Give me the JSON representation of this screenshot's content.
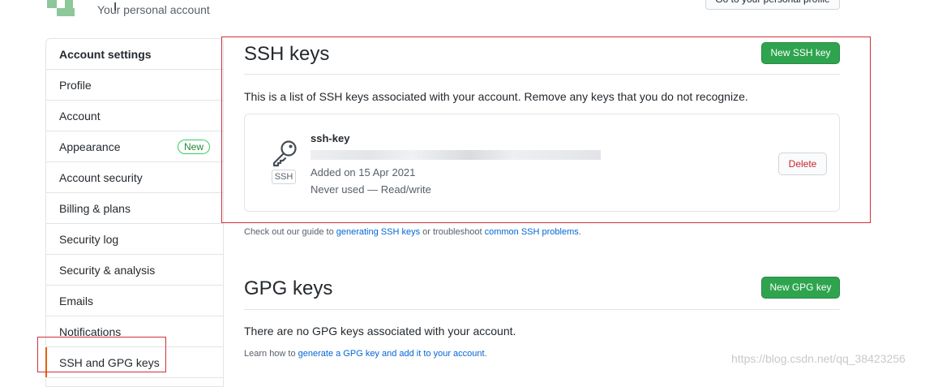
{
  "header": {
    "subtitle": "Your personal account",
    "profile_button": "Go to your personal profile"
  },
  "sidebar": {
    "items": [
      {
        "label": "Account settings"
      },
      {
        "label": "Profile"
      },
      {
        "label": "Account"
      },
      {
        "label": "Appearance",
        "badge": "New"
      },
      {
        "label": "Account security"
      },
      {
        "label": "Billing & plans"
      },
      {
        "label": "Security log"
      },
      {
        "label": "Security & analysis"
      },
      {
        "label": "Emails"
      },
      {
        "label": "Notifications"
      },
      {
        "label": "SSH and GPG keys"
      }
    ]
  },
  "ssh": {
    "title": "SSH keys",
    "new_button": "New SSH key",
    "description": "This is a list of SSH keys associated with your account. Remove any keys that you do not recognize.",
    "key": {
      "icon": "key-icon",
      "type_badge": "SSH",
      "name": "ssh-key",
      "added": "Added on 15 Apr 2021",
      "usage": "Never used — Read/write",
      "delete_button": "Delete"
    },
    "guide_prefix": "Check out our guide to ",
    "guide_link": "generating SSH keys",
    "guide_middle": " or troubleshoot ",
    "guide_link2": "common SSH problems",
    "guide_suffix": "."
  },
  "gpg": {
    "title": "GPG keys",
    "new_button": "New GPG key",
    "empty": "There are no GPG keys associated with your account.",
    "learn_prefix": "Learn how to ",
    "learn_link": "generate a GPG key and add it to your account",
    "learn_suffix": "."
  },
  "watermark": "https://blog.csdn.net/qq_38423256",
  "colors": {
    "accent_green": "#2ea44f",
    "link": "#0366d6",
    "annotation_red": "#d0303a"
  }
}
